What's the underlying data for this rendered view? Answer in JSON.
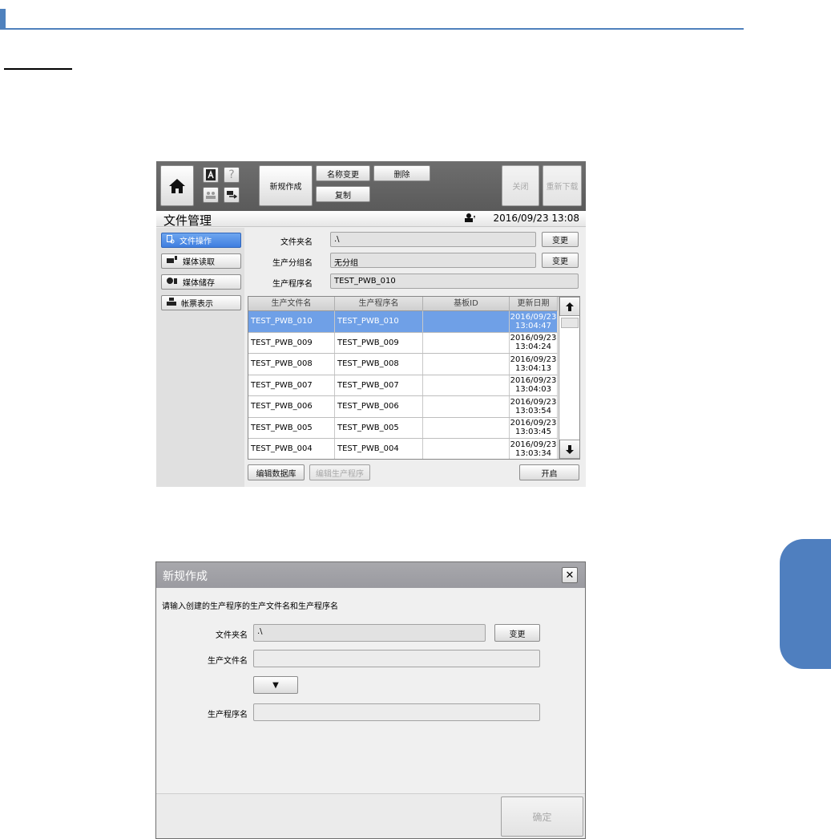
{
  "toolbar": {
    "new_label": "新规作成",
    "rename_label": "名称变更",
    "delete_label": "删除",
    "copy_label": "复制",
    "close_label": "关闭",
    "redownload_label": "重新下载",
    "help_glyph": "?"
  },
  "screen": {
    "title": "文件管理",
    "datetime": "2016/09/23 13:08"
  },
  "sidebar": {
    "items": [
      {
        "label": "文件操作",
        "active": true
      },
      {
        "label": "媒体读取",
        "active": false
      },
      {
        "label": "媒体储存",
        "active": false
      },
      {
        "label": "帐票表示",
        "active": false
      }
    ]
  },
  "fields": {
    "folder_label": "文件夹名",
    "folder_value": ".\\",
    "group_label": "生产分组名",
    "group_value": "无分组",
    "program_label": "生产程序名",
    "program_value": "TEST_PWB_010",
    "change_label": "变更"
  },
  "table": {
    "columns": [
      "生产文件名",
      "生产程序名",
      "基板ID",
      "更新日期"
    ],
    "rows": [
      {
        "file": "TEST_PWB_010",
        "program": "TEST_PWB_010",
        "board_id": "",
        "date": "2016/09/23",
        "time": "13:04:47",
        "selected": true
      },
      {
        "file": "TEST_PWB_009",
        "program": "TEST_PWB_009",
        "board_id": "",
        "date": "2016/09/23",
        "time": "13:04:24",
        "selected": false
      },
      {
        "file": "TEST_PWB_008",
        "program": "TEST_PWB_008",
        "board_id": "",
        "date": "2016/09/23",
        "time": "13:04:13",
        "selected": false
      },
      {
        "file": "TEST_PWB_007",
        "program": "TEST_PWB_007",
        "board_id": "",
        "date": "2016/09/23",
        "time": "13:04:03",
        "selected": false
      },
      {
        "file": "TEST_PWB_006",
        "program": "TEST_PWB_006",
        "board_id": "",
        "date": "2016/09/23",
        "time": "13:03:54",
        "selected": false
      },
      {
        "file": "TEST_PWB_005",
        "program": "TEST_PWB_005",
        "board_id": "",
        "date": "2016/09/23",
        "time": "13:03:45",
        "selected": false
      },
      {
        "file": "TEST_PWB_004",
        "program": "TEST_PWB_004",
        "board_id": "",
        "date": "2016/09/23",
        "time": "13:03:34",
        "selected": false
      }
    ]
  },
  "bottom": {
    "edit_db_label": "编辑数据库",
    "edit_program_label": "编辑生产程序",
    "open_label": "开启"
  },
  "dialog": {
    "title": "新规作成",
    "close_glyph": "✕",
    "message": "请输入创建的生产程序的生产文件名和生产程序名",
    "folder_label": "文件夹名",
    "folder_value": ".\\",
    "change_label": "变更",
    "file_label": "生产文件名",
    "file_value": "",
    "dropdown_glyph": "▼",
    "program_label": "生产程序名",
    "program_value": "",
    "ok_label": "确定"
  }
}
